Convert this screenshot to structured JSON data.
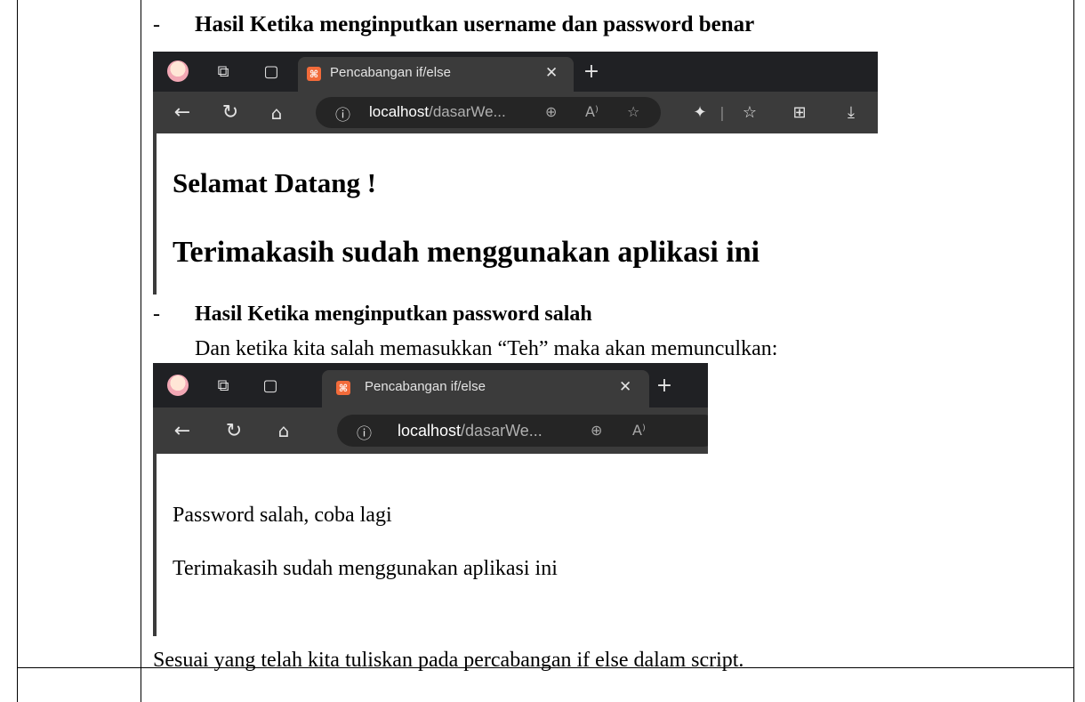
{
  "section1": {
    "bullet": "-",
    "heading": "Hasil Ketika menginputkan username dan password benar"
  },
  "browser1": {
    "tab_title": "Pencabangan if/else",
    "url_host": "localhost",
    "url_rest": "/dasarWe...",
    "content_line1": "Selamat Datang !",
    "content_line2": "Terimakasih sudah menggunakan aplikasi ini"
  },
  "section2": {
    "bullet": "-",
    "heading": "Hasil Ketika menginputkan password salah",
    "description": "Dan ketika kita salah memasukkan “Teh” maka akan memunculkan:"
  },
  "browser2": {
    "tab_title": "Pencabangan if/else",
    "url_host": "localhost",
    "url_rest": "/dasarWe...",
    "content_line1": "Password salah, coba lagi",
    "content_line2": "Terimakasih sudah menggunakan aplikasi ini"
  },
  "conclusion": "Sesuai yang telah kita tuliskan pada percabangan if else dalam script.",
  "icons": {
    "back": "arrow-left-icon",
    "refresh": "refresh-icon",
    "home": "home-icon",
    "info": "info-icon",
    "close": "close-icon",
    "new_tab": "plus-icon"
  }
}
